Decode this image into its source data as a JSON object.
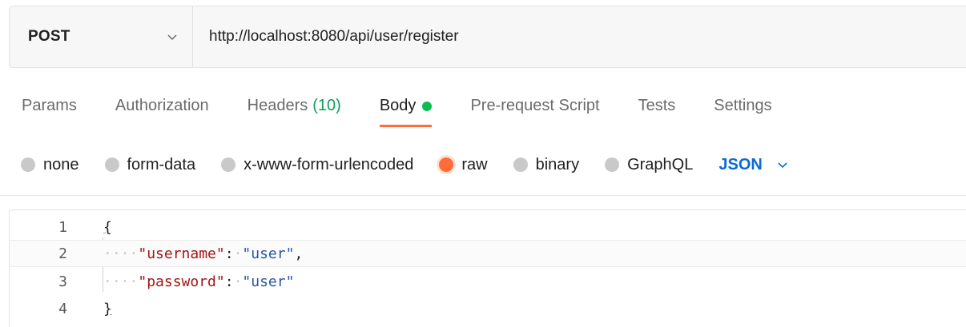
{
  "request": {
    "method": "POST",
    "url": "http://localhost:8080/api/user/register"
  },
  "tabs": [
    {
      "label": "Params"
    },
    {
      "label": "Authorization"
    },
    {
      "label": "Headers",
      "count": "(10)"
    },
    {
      "label": "Body",
      "active": true,
      "indicator_color": "#0cbb52"
    },
    {
      "label": "Pre-request Script"
    },
    {
      "label": "Tests"
    },
    {
      "label": "Settings"
    }
  ],
  "body_types": {
    "options": [
      "none",
      "form-data",
      "x-www-form-urlencoded",
      "raw",
      "binary",
      "GraphQL"
    ],
    "selected": "raw",
    "format": "JSON"
  },
  "editor": {
    "line_numbers": [
      "1",
      "2",
      "3",
      "4"
    ],
    "lines": [
      {
        "open_brace": "{"
      },
      {
        "key": "\"username\"",
        "colon": ":",
        "value": "\"user\"",
        "comma": ","
      },
      {
        "key": "\"password\"",
        "colon": ":",
        "value": "\"user\""
      },
      {
        "close_brace": "}"
      }
    ]
  },
  "colors": {
    "accent": "#ff6c37",
    "link": "#0b6cd6",
    "success": "#0f9d58",
    "json_key": "#a31515",
    "json_string": "#2756a6"
  }
}
